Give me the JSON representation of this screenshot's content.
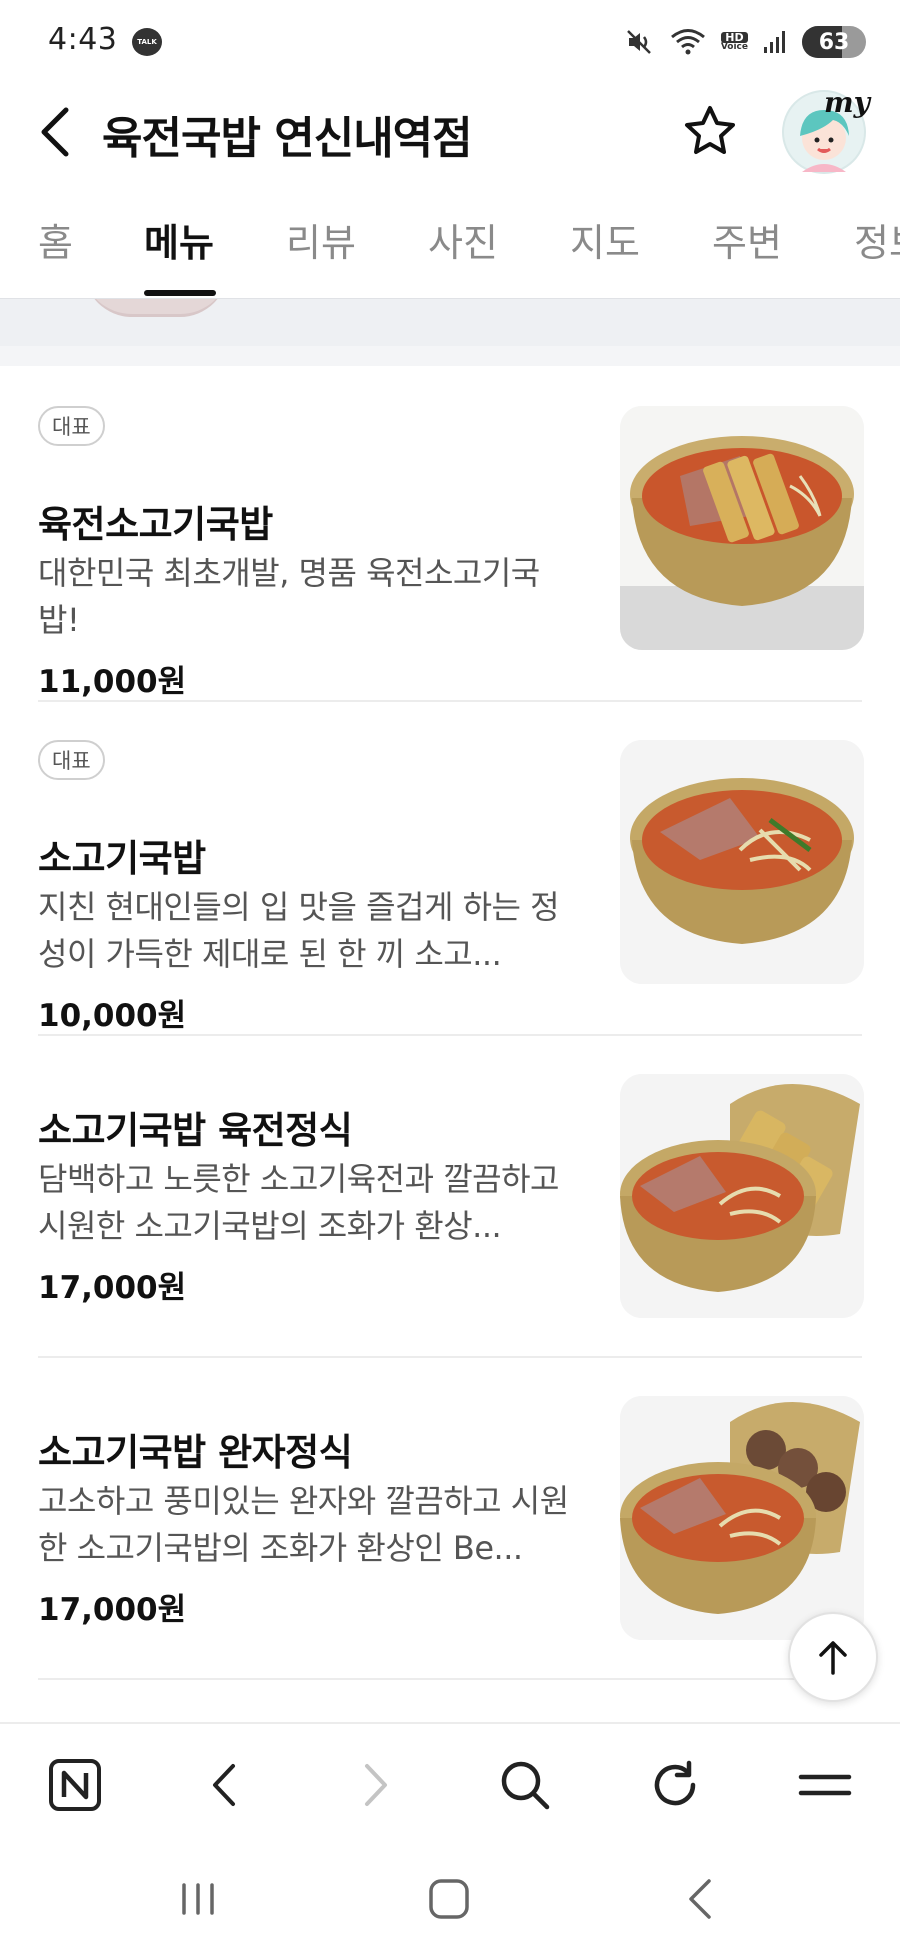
{
  "status": {
    "time": "4:43",
    "talk_badge": "TALK",
    "hd_voice_top": "HD",
    "hd_voice_bottom": "Voice",
    "battery_level": "63",
    "battery_fill_fraction": 0.63
  },
  "header": {
    "title": "육전국밥 연신내역점",
    "my_label": "my"
  },
  "tabs": [
    {
      "label": "홈",
      "active": false
    },
    {
      "label": "메뉴",
      "active": true
    },
    {
      "label": "리뷰",
      "active": false
    },
    {
      "label": "사진",
      "active": false
    },
    {
      "label": "지도",
      "active": false
    },
    {
      "label": "주변",
      "active": false
    },
    {
      "label": "정보",
      "active": false
    }
  ],
  "menu": {
    "items": [
      {
        "badge": "대표",
        "name": "육전소고기국밥",
        "description": "대한민국 최초개발, 명품 육전소고기국밥!",
        "price": "11,000원",
        "photo": "soup-with-meat-jeon"
      },
      {
        "badge": "대표",
        "name": "소고기국밥",
        "description": "지친 현대인들의 입 맛을 즐겁게 하는 정성이 가득한 제대로 된 한 끼 소고...",
        "price": "10,000원",
        "photo": "beef-soup"
      },
      {
        "badge": "",
        "name": "소고기국밥 육전정식",
        "description": "담백하고 노릇한 소고기육전과 깔끔하고 시원한 소고기국밥의 조화가 환상...",
        "price": "17,000원",
        "photo": "beef-soup-with-jeon-plate"
      },
      {
        "badge": "",
        "name": "소고기국밥 완자정식",
        "description": "고소하고 풍미있는 완자와 깔끔하고 시원한 소고기국밥의 조화가 환상인 Be...",
        "price": "17,000원",
        "photo": "beef-soup-with-meatball-plate"
      }
    ]
  },
  "toolbar": {
    "icons": [
      "naver-n-icon",
      "back-arrow-icon",
      "forward-arrow-icon",
      "search-icon",
      "refresh-icon",
      "menu-icon"
    ]
  },
  "system_nav": {
    "icons": [
      "recent-apps-icon",
      "home-icon",
      "system-back-icon"
    ]
  }
}
